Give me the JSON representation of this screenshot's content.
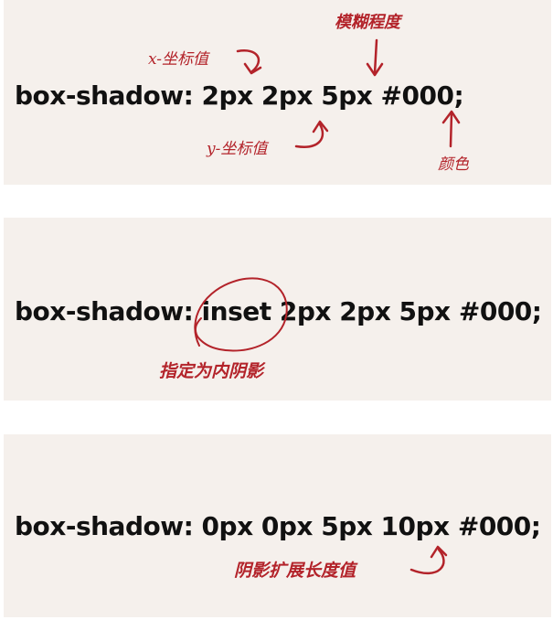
{
  "snippets": [
    {
      "code": "box-shadow: 2px 2px 5px #000;"
    },
    {
      "code": "box-shadow: inset 2px 2px 5px #000;"
    },
    {
      "code": "box-shadow: 0px 0px 5px 10px #000;"
    }
  ],
  "annotations": {
    "x_offset": "x-坐标值",
    "blur": "模糊程度",
    "y_offset": "y-坐标值",
    "color": "颜色",
    "inset": "指定为内阴影",
    "spread": "阴影扩展长度值"
  },
  "colors": {
    "panel_background": "#f5f0ec",
    "annotation_ink": "#b3232a",
    "code_text": "#111111"
  }
}
